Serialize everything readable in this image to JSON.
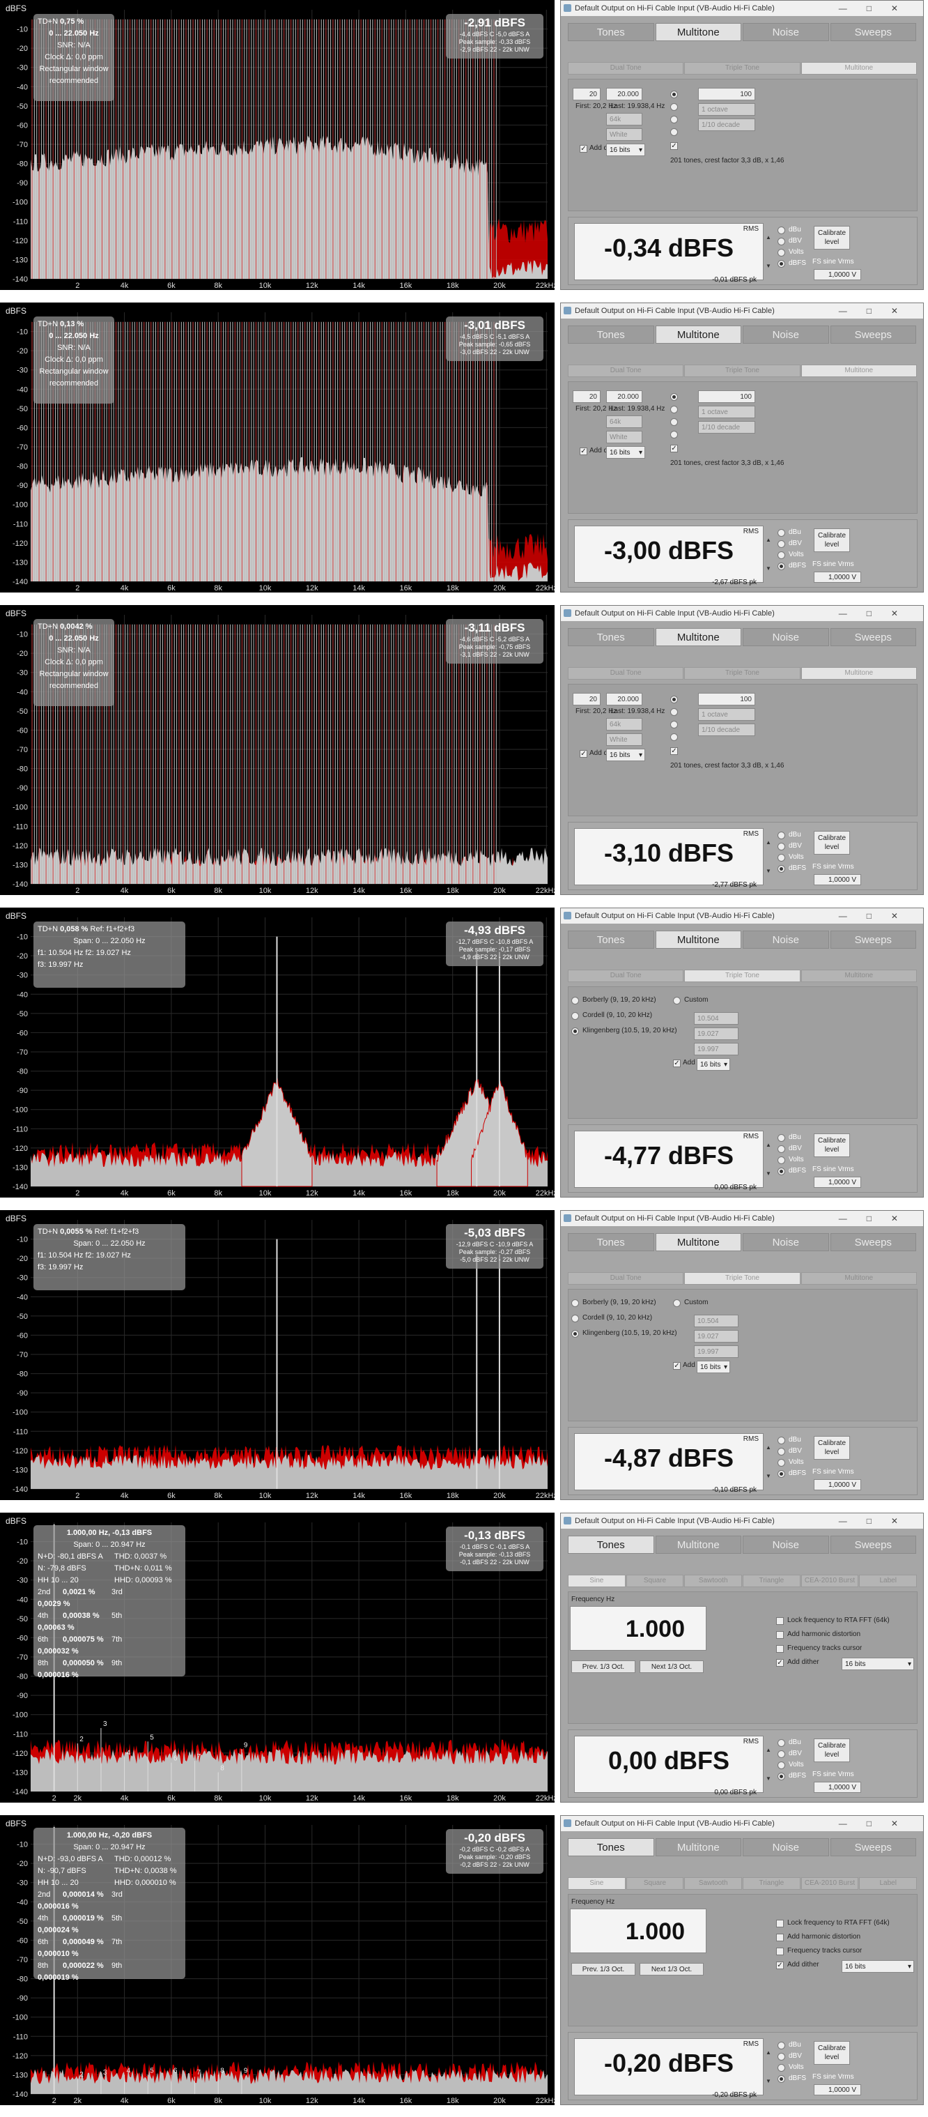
{
  "common": {
    "unit_label": "dBFS",
    "y_ticks": [
      "-10",
      "-20",
      "-30",
      "-40",
      "-50",
      "-60",
      "-70",
      "-80",
      "-90",
      "-100",
      "-110",
      "-120",
      "-130",
      "-140"
    ],
    "x_ticks": [
      "2",
      "4k",
      "6k",
      "8k",
      "10k",
      "12k",
      "14k",
      "16k",
      "18k",
      "20k",
      "22kHz"
    ],
    "x_ticks_alt": [
      "2",
      "2k",
      "4k",
      "6k",
      "8k",
      "10k",
      "12k",
      "14k",
      "16k",
      "18k",
      "20k",
      "22kHz"
    ],
    "window_title": "Default Output on Hi-Fi Cable Input (VB-Audio Hi-Fi Cable)",
    "tabs": [
      "Tones",
      "Multitone",
      "Noise",
      "Sweeps"
    ],
    "sub_multitone": [
      "Dual Tone",
      "Triple Tone",
      "Multitone"
    ],
    "sub_tones": [
      "Sine",
      "Square",
      "Sawtooth",
      "Triangle",
      "CEA-2010 Burst",
      "Label"
    ],
    "rms_label": "RMS",
    "units": [
      "dBu",
      "dBV",
      "Volts",
      "dBFS"
    ],
    "calibrate": "Calibrate level",
    "fs_sine": "FS sine Vrms",
    "fs_value": "1,0000 V",
    "first_label": "First: 20,2 Hz",
    "last_label": "Last: 19.938,4 Hz",
    "first_value": "20",
    "last_value": "20.000",
    "n_tones": "100",
    "octave": "1 octave",
    "decade": "1/10 decade",
    "f64": "64k",
    "white": "White",
    "add_dither": "Add dither",
    "bits": "16 bits",
    "tones_info": "201 tones, crest factor 3,3 dB, x 1,46",
    "tt_options": [
      "Borberly (9, 19, 20 kHz)",
      "Cordell (9, 10, 20 kHz)",
      "Klingenberg (10.5, 19, 20 kHz)"
    ],
    "tt_custom": "Custom",
    "tt_values": [
      "10.504",
      "19.027",
      "19.997"
    ],
    "freq_hz": "Frequency Hz",
    "freq_value": "1.000",
    "lock_freq": "Lock frequency to RTA FFT (64k)",
    "add_harm": "Add harmonic distortion",
    "freq_tracks": "Frequency tracks cursor",
    "prev_oct": "Prev. 1/3 Oct.",
    "next_oct": "Next 1/3 Oct."
  },
  "panels": [
    {
      "kind": "multitone",
      "info": {
        "tdn_label": "TD+N",
        "tdn": "0,75 %",
        "range": "0 ... 22.050 Hz",
        "snr": "SNR: N/A",
        "clock": "Clock Δ: 0,0 ppm",
        "note1": "Rectangular window",
        "note2": "recommended"
      },
      "level": {
        "main": "-2,91 dBFS",
        "l1": "-4,4 dBFS C  -5,0 dBFS A",
        "l2": "Peak sample: -0,33 dBFS",
        "l3": "-2,9 dBFS 22 - 22k UNW"
      },
      "rms": "-0,34 dBFS",
      "peak": "-0,01 dBFS pk",
      "floor": -115,
      "shelf_top": -80,
      "rolloff": 18
    },
    {
      "kind": "multitone",
      "info": {
        "tdn_label": "TD+N",
        "tdn": "0,13 %",
        "range": "0 ... 22.050 Hz",
        "snr": "SNR: N/A",
        "clock": "Clock Δ: 0,0 ppm",
        "note1": "Rectangular window",
        "note2": "recommended"
      },
      "level": {
        "main": "-3,01 dBFS",
        "l1": "-4,5 dBFS C  -5,1 dBFS A",
        "l2": "Peak sample: -0,65 dBFS",
        "l3": "-3,0 dBFS 22 - 22k UNW"
      },
      "rms": "-3,00 dBFS",
      "peak": "-2,67 dBFS pk",
      "floor": -122,
      "shelf_top": -90,
      "rolloff": 15
    },
    {
      "kind": "multitone",
      "info": {
        "tdn_label": "TD+N",
        "tdn": "0,0042 %",
        "range": "0 ... 22.050 Hz",
        "snr": "SNR: N/A",
        "clock": "Clock Δ: 0,0 ppm",
        "note1": "Rectangular window",
        "note2": "recommended"
      },
      "level": {
        "main": "-3,11 dBFS",
        "l1": "-4,6 dBFS C  -5,2 dBFS A",
        "l2": "Peak sample: -0,75 dBFS",
        "l3": "-3,1 dBFS 22 - 22k UNW"
      },
      "rms": "-3,10 dBFS",
      "peak": "-2,77 dBFS pk",
      "floor": -132,
      "shelf_top": -126,
      "rolloff": 0
    },
    {
      "kind": "triple",
      "info": {
        "tdn_label": "TD+N",
        "tdn": "0,058 %",
        "ref": "Ref: f1+f2+f3",
        "span": "Span: 0 ... 22.050 Hz",
        "f1": "f1: 10.504 Hz",
        "f2": "f2: 19.027 Hz",
        "f3": "f3: 19.997 Hz"
      },
      "level": {
        "main": "-4,93 dBFS",
        "l1": "-12,7 dBFS C  -10,8 dBFS A",
        "l2": "Peak sample: -0,17 dBFS",
        "l3": "-4,9 dBFS 22 - 22k UNW"
      },
      "rms": "-4,77 dBFS",
      "peak": "0,00 dBFS pk",
      "skirts": true
    },
    {
      "kind": "triple",
      "info": {
        "tdn_label": "TD+N",
        "tdn": "0,0055 %",
        "ref": "Ref: f1+f2+f3",
        "span": "Span: 0 ... 22.050 Hz",
        "f1": "f1: 10.504 Hz",
        "f2": "f2: 19.027 Hz",
        "f3": "f3: 19.997 Hz"
      },
      "level": {
        "main": "-5,03 dBFS",
        "l1": "-12,9 dBFS C  -10,9 dBFS A",
        "l2": "Peak sample: -0,27 dBFS",
        "l3": "-5,0 dBFS 22 - 22k UNW"
      },
      "rms": "-4,87 dBFS",
      "peak": "-0,10 dBFS pk",
      "skirts": false
    },
    {
      "kind": "sine",
      "info": {
        "head": "1.000,00 Hz, -0,13 dBFS",
        "span": "Span: 0 ... 20.947 Hz",
        "n": "N+D: -80,1 dBFS A",
        "thd": "THD: 0,0037 %",
        "n2": "N: -79,8 dBFS",
        "thdn": "THD+N: 0,011 %",
        "hh": "HH 10 ... 20",
        "hhd": "HHD: 0,00093 %",
        "h": [
          [
            "2nd",
            "0,0021 %",
            "3rd",
            "0,0029 %"
          ],
          [
            "4th",
            "0,00038 %",
            "5th",
            "0,00063 %"
          ],
          [
            "6th",
            "0,000075 %",
            "7th",
            "0,000032 %"
          ],
          [
            "8th",
            "0,000050 %",
            "9th",
            "0,000016 %"
          ]
        ]
      },
      "level": {
        "main": "-0,13 dBFS",
        "l1": "-0,1 dBFS C  -0,1 dBFS A",
        "l2": "Peak sample: -0,13 dBFS",
        "l3": "-0,1 dBFS 22 - 22k UNW"
      },
      "rms": "0,00 dBFS",
      "peak": "0,00 dBFS pk",
      "harmonics": true
    },
    {
      "kind": "sine",
      "info": {
        "head": "1.000,00 Hz, -0,20 dBFS",
        "span": "Span: 0 ... 20.947 Hz",
        "n": "N+D: -93,0 dBFS A",
        "thd": "THD: 0,00012 %",
        "n2": "N: -90,7 dBFS",
        "thdn": "THD+N: 0,0038 %",
        "hh": "HH 10 ... 20",
        "hhd": "HHD: 0,000010 %",
        "h": [
          [
            "2nd",
            "0,000014 %",
            "3rd",
            "0,000016 %"
          ],
          [
            "4th",
            "0,000019 %",
            "5th",
            "0,000024 %"
          ],
          [
            "6th",
            "0,000049 %",
            "7th",
            "0,000010 %"
          ],
          [
            "8th",
            "0,000022 %",
            "9th",
            "0,000019 %"
          ]
        ]
      },
      "level": {
        "main": "-0,20 dBFS",
        "l1": "-0,2 dBFS C  -0,2 dBFS A",
        "l2": "Peak sample: -0,20 dBFS",
        "l3": "-0,2 dBFS 22 - 22k UNW"
      },
      "rms": "-0,20 dBFS",
      "peak": "-0,20 dBFS pk",
      "harmonics": false
    }
  ],
  "chart_data": {
    "type": "line",
    "title": "",
    "xlabel": "",
    "ylabel": "dBFS",
    "xlim": [
      0,
      22050
    ],
    "ylim": [
      -140,
      0
    ]
  }
}
